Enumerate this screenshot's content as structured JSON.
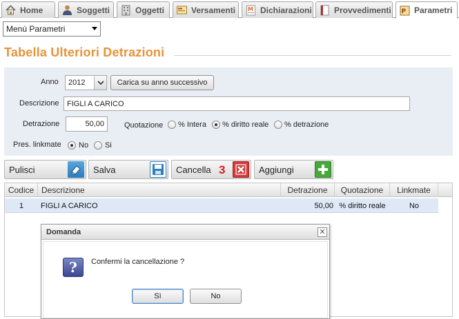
{
  "tabs": [
    {
      "label": "Home",
      "icon": "home-icon"
    },
    {
      "label": "Soggetti",
      "icon": "person-icon"
    },
    {
      "label": "Oggetti",
      "icon": "building-icon"
    },
    {
      "label": "Versamenti",
      "icon": "payment-icon"
    },
    {
      "label": "Dichiarazioni",
      "icon": "declaration-icon"
    },
    {
      "label": "Provvedimenti",
      "icon": "book-icon"
    },
    {
      "label": "Parametri",
      "icon": "parameters-icon",
      "active": true
    }
  ],
  "menu_select": {
    "value": "Menù Parametri"
  },
  "section_title": "Tabella Ulteriori Detrazioni",
  "form": {
    "anno_label": "Anno",
    "anno_value": "2012",
    "carica_button": "Carica su anno successivo",
    "descrizione_label": "Descrizione",
    "descrizione_value": "FIGLI A CARICO",
    "detrazione_label": "Detrazione",
    "detrazione_value": "50,00",
    "quotazione_label": "Quotazione",
    "quotazione_options": [
      "% Intera",
      "% diritto reale",
      "% detrazione"
    ],
    "quotazione_selected": "% diritto reale",
    "linkmate_label": "Pres. linkmate",
    "linkmate_options": [
      "No",
      "Si"
    ],
    "linkmate_selected": "No"
  },
  "actions": {
    "pulisci": "Pulisci",
    "salva": "Salva",
    "cancella": "Cancella",
    "cancella_badge": "3",
    "aggiungi": "Aggiungi"
  },
  "table": {
    "headers": [
      "Codice",
      "Descrizione",
      "Detrazione",
      "Quotazione",
      "Linkmate"
    ],
    "rows": [
      {
        "codice": "1",
        "descrizione": "FIGLI A CARICO",
        "detrazione": "50,00",
        "quotazione": "% diritto reale",
        "linkmate": "No"
      }
    ]
  },
  "dialog": {
    "title": "Domanda",
    "close": "✕",
    "icon": "question-icon",
    "message": "Confermi la cancellazione ?",
    "yes": "Sì",
    "no": "No"
  },
  "colors": {
    "accent_title": "#e8923a",
    "panel_bg": "#e9eef4",
    "selected_row": "#dfe8f6",
    "badge_red": "#d42020",
    "save_blue": "#2f7fbf",
    "delete_red": "#d33a3a",
    "add_green": "#46a93a"
  }
}
